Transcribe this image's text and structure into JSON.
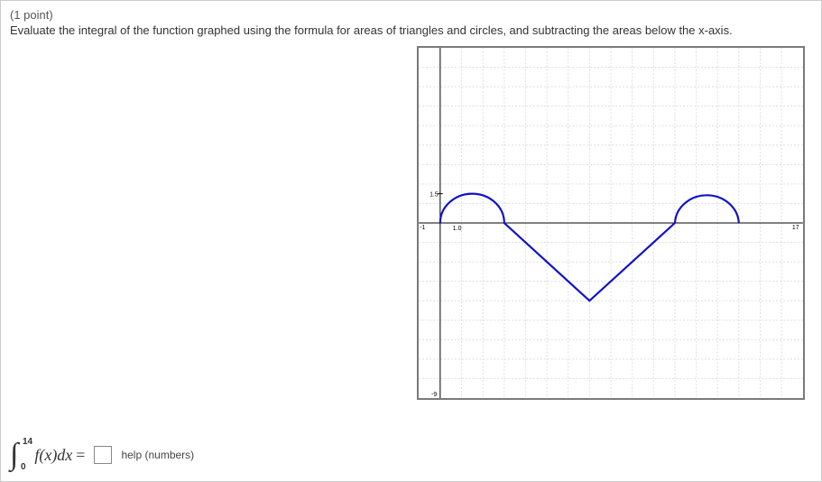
{
  "points_label": "(1 point)",
  "prompt": "Evaluate the integral of the function graphed using the formula for areas of triangles and circles, and subtracting the areas below the x-axis.",
  "integral": {
    "upper": "14",
    "lower": "0",
    "integrand": "f(x)dx",
    "equals": "="
  },
  "answer_value": "",
  "help_text": "help (numbers)",
  "chart_data": {
    "type": "line",
    "xlabel": "",
    "ylabel": "",
    "xlim": [
      -1,
      17
    ],
    "ylim": [
      -9,
      9
    ],
    "x_ticks": [
      -1,
      17
    ],
    "y_ticks": [
      -9,
      1.5
    ],
    "axis_labels": {
      "x_axis_right": "17",
      "x_axis_left": "-1",
      "y_axis_top_tick": "1.5",
      "y_axis_bottom_tick": "-9",
      "origin_right": "1.0"
    },
    "description": "Piecewise curve over [0,14]: upper semicircle of radius 1.5 centered at (1.5,0) on [0,3]; straight line from (3,0) down to (7,-4) on [3,7]; straight line from (7,-4) up to (11,0) on [7,11]; upper semicircle of radius 1.5 centered at (12.5,0) on [11,14].",
    "pieces": [
      {
        "type": "semicircle_upper",
        "center": [
          1.5,
          0
        ],
        "radius": 1.5,
        "x_range": [
          0,
          3
        ]
      },
      {
        "type": "line_segment",
        "from": [
          3,
          0
        ],
        "to": [
          7,
          -4
        ]
      },
      {
        "type": "line_segment",
        "from": [
          7,
          -4
        ],
        "to": [
          11,
          0
        ]
      },
      {
        "type": "semicircle_upper",
        "center": [
          12.5,
          0
        ],
        "radius": 1.5,
        "x_range": [
          11,
          14
        ]
      }
    ]
  }
}
